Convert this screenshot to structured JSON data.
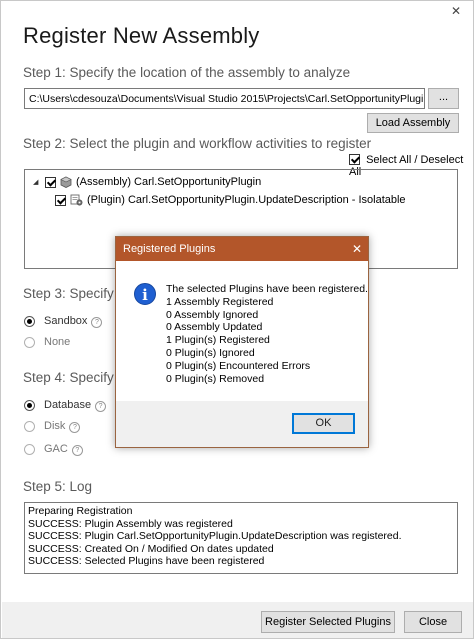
{
  "window": {
    "title": "Register New Assembly"
  },
  "step1": {
    "label": "Step 1: Specify the location of the assembly to analyze",
    "path_value": "C:\\Users\\cdesouza\\Documents\\Visual Studio 2015\\Projects\\Carl.SetOpportunityPlugin\\Carl.Set",
    "browse_label": "...",
    "load_label": "Load Assembly"
  },
  "step2": {
    "label": "Step 2: Select the plugin and workflow activities to register",
    "select_all_label": "Select All / Deselect All",
    "tree": [
      {
        "label": "(Assembly) Carl.SetOpportunityPlugin",
        "checked": true,
        "icon": "assembly-icon"
      },
      {
        "label": "(Plugin) Carl.SetOpportunityPlugin.UpdateDescription - Isolatable",
        "checked": true,
        "icon": "plugin-icon"
      }
    ]
  },
  "step3": {
    "label": "Step 3: Specify the",
    "options": [
      {
        "label": "Sandbox",
        "selected": true
      },
      {
        "label": "None",
        "selected": false
      }
    ]
  },
  "step4": {
    "label": "Step 4: Specify the",
    "options": [
      {
        "label": "Database",
        "selected": true
      },
      {
        "label": "Disk",
        "selected": false
      },
      {
        "label": "GAC",
        "selected": false
      }
    ]
  },
  "step5": {
    "label": "Step 5: Log",
    "lines": [
      "Preparing Registration",
      "SUCCESS: Plugin Assembly was registered",
      "SUCCESS: Plugin Carl.SetOpportunityPlugin.UpdateDescription was registered.",
      "SUCCESS: Created On / Modified On dates updated",
      "SUCCESS: Selected Plugins have been registered"
    ]
  },
  "footer": {
    "register_label": "Register Selected Plugins",
    "close_label": "Close"
  },
  "dialog": {
    "title": "Registered Plugins",
    "close_glyph": "✕",
    "lines": [
      "The selected Plugins have been registered.",
      "1 Assembly Registered",
      "0 Assembly Ignored",
      "0 Assembly Updated",
      "1 Plugin(s) Registered",
      "0 Plugin(s) Ignored",
      "0 Plugin(s) Encountered Errors",
      "0 Plugin(s) Removed"
    ],
    "ok_label": "OK"
  },
  "colors": {
    "dialog_title_bg": "#b3562a",
    "info_icon": "#1f5fd1",
    "ok_focus": "#0078d7"
  }
}
